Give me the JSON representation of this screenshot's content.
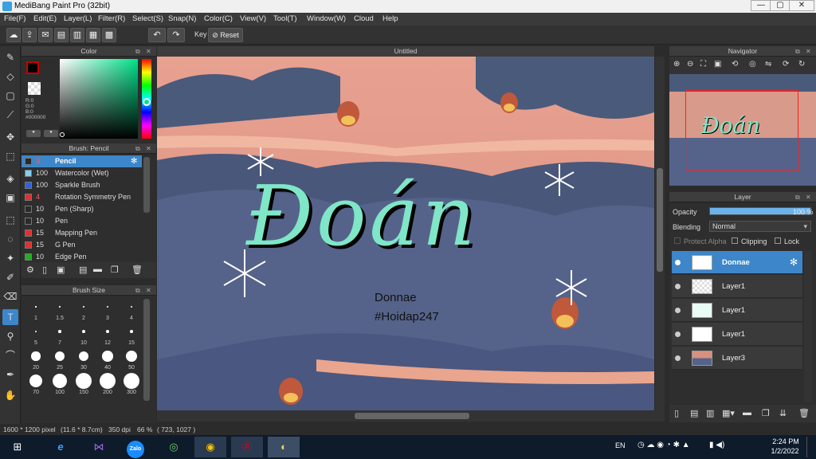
{
  "window": {
    "title": "MediBang Paint Pro (32bit)",
    "min": "—",
    "max": "▢",
    "close": "✕"
  },
  "menu": [
    "File(F)",
    "Edit(E)",
    "Layer(L)",
    "Filter(R)",
    "Select(S)",
    "Snap(N)",
    "Color(C)",
    "View(V)",
    "Tool(T)",
    "Window(W)",
    "Cloud",
    "Help"
  ],
  "toolbar": {
    "key_label": "Key",
    "reset_label": "Reset"
  },
  "color_panel": {
    "title": "Color",
    "readout": [
      "R:0",
      "G:0",
      "B:0",
      "#000000"
    ],
    "fg_color": "#000000",
    "accent": "#c80000"
  },
  "brush_panel": {
    "title": "Brush: Pencil",
    "brushes": [
      {
        "size": "3",
        "name": "Pencil",
        "color": "#2a2a2a"
      },
      {
        "size": "100",
        "name": "Watercolor (Wet)",
        "color": "#7fd0f0"
      },
      {
        "size": "100",
        "name": "Sparkle Brush",
        "color": "#3060e0"
      },
      {
        "size": "4",
        "name": "Rotation Symmetry Pen",
        "color": "#e03030"
      },
      {
        "size": "10",
        "name": "Pen (Sharp)",
        "color": "#2a2a2a"
      },
      {
        "size": "10",
        "name": "Pen",
        "color": "#2a2a2a"
      },
      {
        "size": "15",
        "name": "Mapping Pen",
        "color": "#e03030"
      },
      {
        "size": "15",
        "name": "G Pen",
        "color": "#e03030"
      },
      {
        "size": "10",
        "name": "Edge Pen",
        "color": "#20b020"
      }
    ]
  },
  "brush_size_panel": {
    "title": "Brush Size",
    "sizes": [
      "1",
      "1.5",
      "2",
      "3",
      "4",
      "5",
      "7",
      "10",
      "12",
      "15",
      "20",
      "25",
      "30",
      "40",
      "50",
      "70",
      "100",
      "150",
      "200",
      "300"
    ]
  },
  "canvas": {
    "title": "Untitled",
    "lettering": "Đoán",
    "credit_name": "Donnae",
    "credit_tag": "#Hoidap247"
  },
  "navigator": {
    "title": "Navigator"
  },
  "layer_panel": {
    "title": "Layer",
    "opacity_label": "Opacity",
    "opacity_value": "100 %",
    "opacity_fraction": 1.0,
    "blending_label": "Blending",
    "blending_value": "Normal",
    "protect_alpha": "Protect Alpha",
    "clipping": "Clipping",
    "lock": "Lock",
    "layers": [
      {
        "name": "Donnae",
        "selected": true
      },
      {
        "name": "Layer1",
        "selected": false
      },
      {
        "name": "Layer1",
        "selected": false
      },
      {
        "name": "Layer1",
        "selected": false
      },
      {
        "name": "Layer3",
        "selected": false
      }
    ]
  },
  "status": {
    "size": "1600 * 1200 pixel",
    "physical": "(11.6 * 8.7cm)",
    "dpi": "350 dpi",
    "zoom": "66 %",
    "cursor": "( 723, 1027 )"
  },
  "taskbar": {
    "apps": [
      "Zalo"
    ],
    "lang": "EN",
    "time": "2:24 PM",
    "date": "1/2/2022"
  }
}
